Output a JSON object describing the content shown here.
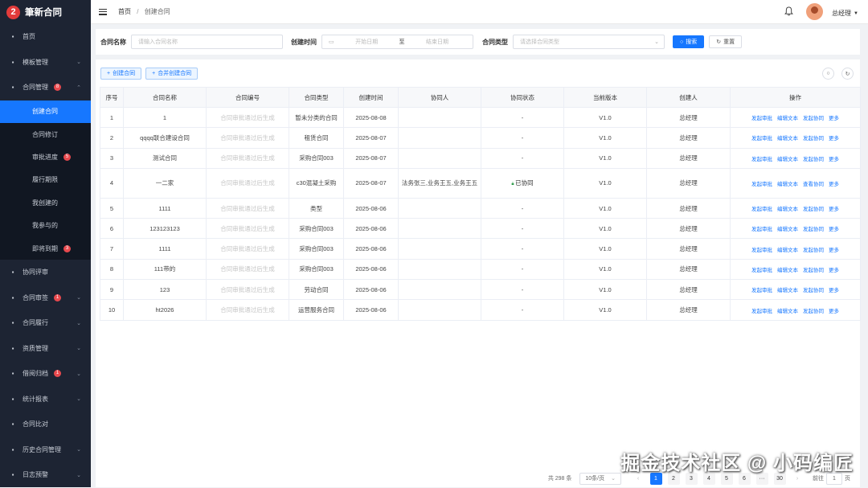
{
  "app": {
    "logo_char": "2",
    "logo_text": "筆新合同"
  },
  "sidebar": {
    "items": [
      {
        "label": "首页",
        "icon": "home-icon",
        "badge": null,
        "arrow": ""
      },
      {
        "label": "模板管理",
        "icon": "template-icon",
        "badge": null,
        "arrow": "⌄"
      },
      {
        "label": "合同管理",
        "icon": "edit-icon",
        "badge": "8",
        "arrow": "⌃"
      }
    ],
    "sub_items": [
      {
        "label": "创建合同",
        "badge": null,
        "active": true
      },
      {
        "label": "合同修订",
        "badge": null,
        "active": false
      },
      {
        "label": "审批进度",
        "badge": "5",
        "active": false
      },
      {
        "label": "履行期限",
        "badge": null,
        "active": false
      },
      {
        "label": "我创建的",
        "badge": null,
        "active": false
      },
      {
        "label": "我参与的",
        "badge": null,
        "active": false
      },
      {
        "label": "即将到期",
        "badge": "3",
        "active": false
      }
    ],
    "items_after": [
      {
        "label": "协同评审",
        "icon": "network-icon",
        "badge": null,
        "arrow": ""
      },
      {
        "label": "合同审签",
        "icon": "sign-icon",
        "badge": "1",
        "arrow": "⌄"
      },
      {
        "label": "合同履行",
        "icon": "perform-icon",
        "badge": null,
        "arrow": "⌄"
      },
      {
        "label": "资质管理",
        "icon": "grid-icon",
        "badge": null,
        "arrow": "⌄"
      },
      {
        "label": "借阅归档",
        "icon": "archive-icon",
        "badge": "1",
        "arrow": "⌄"
      },
      {
        "label": "统计报表",
        "icon": "chart-icon",
        "badge": null,
        "arrow": "⌄"
      },
      {
        "label": "合同比对",
        "icon": "compare-icon",
        "badge": null,
        "arrow": ""
      },
      {
        "label": "历史合同管理",
        "icon": "history-icon",
        "badge": null,
        "arrow": "⌄"
      },
      {
        "label": "日志预警",
        "icon": "log-icon",
        "badge": null,
        "arrow": "⌄"
      }
    ]
  },
  "header": {
    "breadcrumb_home": "首页",
    "breadcrumb_sep": "/",
    "breadcrumb_current": "创建合同",
    "user_name": "总经理"
  },
  "filter": {
    "name_label": "合同名称",
    "name_placeholder": "请输入合同名称",
    "time_label": "创建时间",
    "start_placeholder": "开始日期",
    "range_sep": "至",
    "end_placeholder": "结束日期",
    "type_label": "合同类型",
    "type_placeholder": "请选择合同类型",
    "search_label": "搜索",
    "reset_label": "重置"
  },
  "toolbar": {
    "create_label": "创建合同",
    "merge_label": "合并创建合同"
  },
  "table": {
    "columns": [
      "序号",
      "合同名称",
      "合同编号",
      "合同类型",
      "创建时间",
      "协同人",
      "协同状态",
      "当前版本",
      "创建人",
      "操作"
    ],
    "rows": [
      {
        "no": "1",
        "name": "1",
        "code": "合同审批通过后生成",
        "type": "暂未分类的合同",
        "time": "2025-08-08",
        "collab": "",
        "status": "-",
        "version": "V1.0",
        "creator": "总经理",
        "op3": "发起协同"
      },
      {
        "no": "2",
        "name": "qqqq联合建设合同",
        "code": "合同审批通过后生成",
        "type": "租赁合同",
        "time": "2025-08-07",
        "collab": "",
        "status": "-",
        "version": "V1.0",
        "creator": "总经理",
        "op3": "发起协同"
      },
      {
        "no": "3",
        "name": "测试合同",
        "code": "合同审批通过后生成",
        "type": "采购合同003",
        "time": "2025-08-07",
        "collab": "",
        "status": "-",
        "version": "V1.0",
        "creator": "总经理",
        "op3": "发起协同"
      },
      {
        "no": "4",
        "name": "一二家",
        "code": "合同审批通过后生成",
        "type": "c30混凝土采购",
        "time": "2025-08-07",
        "collab": "法务张三,业务王五,业务王五",
        "status": "已协同",
        "version": "V1.0",
        "creator": "总经理",
        "op3": "查看协同"
      },
      {
        "no": "5",
        "name": "1111",
        "code": "合同审批通过后生成",
        "type": "类型",
        "time": "2025-08-06",
        "collab": "",
        "status": "-",
        "version": "V1.0",
        "creator": "总经理",
        "op3": "发起协同"
      },
      {
        "no": "6",
        "name": "123123123",
        "code": "合同审批通过后生成",
        "type": "采购合同003",
        "time": "2025-08-06",
        "collab": "",
        "status": "-",
        "version": "V1.0",
        "creator": "总经理",
        "op3": "发起协同"
      },
      {
        "no": "7",
        "name": "1111",
        "code": "合同审批通过后生成",
        "type": "采购合同003",
        "time": "2025-08-06",
        "collab": "",
        "status": "-",
        "version": "V1.0",
        "creator": "总经理",
        "op3": "发起协同"
      },
      {
        "no": "8",
        "name": "111带的",
        "code": "合同审批通过后生成",
        "type": "采购合同003",
        "time": "2025-08-06",
        "collab": "",
        "status": "-",
        "version": "V1.0",
        "creator": "总经理",
        "op3": "发起协同"
      },
      {
        "no": "9",
        "name": "123",
        "code": "合同审批通过后生成",
        "type": "劳动合同",
        "time": "2025-08-06",
        "collab": "",
        "status": "-",
        "version": "V1.0",
        "creator": "总经理",
        "op3": "发起协同"
      },
      {
        "no": "10",
        "name": "ht2026",
        "code": "合同审批通过后生成",
        "type": "运营服务合同",
        "time": "2025-08-06",
        "collab": "",
        "status": "-",
        "version": "V1.0",
        "creator": "总经理",
        "op3": "发起协同"
      }
    ],
    "op1": "发起审批",
    "op2": "编辑文本",
    "op4": "更多"
  },
  "pagination": {
    "total": "共 298 条",
    "page_size": "10条/页",
    "pages": [
      "1",
      "2",
      "3",
      "4",
      "5",
      "6",
      "···",
      "30"
    ],
    "current": "1",
    "goto_label": "前往",
    "goto_value": "1",
    "goto_suffix": "页"
  },
  "watermark": "掘金技术社区 @ 小码编匠",
  "colors": {
    "primary": "#1677ff",
    "sidebar": "#1d2433",
    "badge": "#e8494e"
  }
}
